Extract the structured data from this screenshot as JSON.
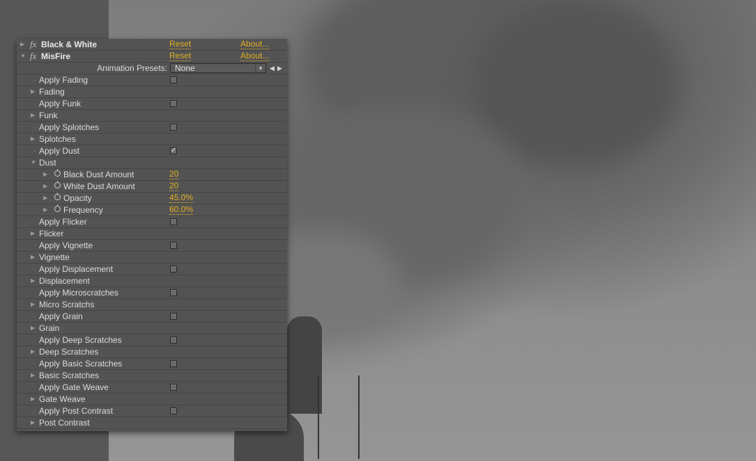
{
  "effects": [
    {
      "name": "Black & White",
      "expanded": false,
      "reset_label": "Reset",
      "about_label": "About..."
    },
    {
      "name": "MisFire",
      "expanded": true,
      "reset_label": "Reset",
      "about_label": "About..."
    }
  ],
  "presets": {
    "label": "Animation Presets:",
    "value": "None"
  },
  "icons": {
    "fx": "fx",
    "twirl_closed": "▶",
    "twirl_open": "▼",
    "dot": "·",
    "dropdown": "▼",
    "prev": "◀",
    "next": "▶",
    "check": "✓"
  },
  "rows": [
    {
      "type": "checkbox",
      "label": "Apply Fading",
      "checked": false
    },
    {
      "type": "group",
      "label": "Fading",
      "expanded": false
    },
    {
      "type": "checkbox",
      "label": "Apply Funk",
      "checked": false
    },
    {
      "type": "group",
      "label": "Funk",
      "expanded": false
    },
    {
      "type": "checkbox",
      "label": "Apply Splotches",
      "checked": false
    },
    {
      "type": "group",
      "label": "Splotches",
      "expanded": false
    },
    {
      "type": "checkbox",
      "label": "Apply Dust",
      "checked": true
    },
    {
      "type": "group",
      "label": "Dust",
      "expanded": true
    },
    {
      "type": "param",
      "label": "Black Dust Amount",
      "value": "20"
    },
    {
      "type": "param",
      "label": "White Dust Amount",
      "value": "20"
    },
    {
      "type": "param",
      "label": "Opacity",
      "value": "45.0%"
    },
    {
      "type": "param",
      "label": "Frequency",
      "value": "60.0%"
    },
    {
      "type": "checkbox",
      "label": "Apply Flicker",
      "checked": false
    },
    {
      "type": "group",
      "label": "Flicker",
      "expanded": false
    },
    {
      "type": "checkbox",
      "label": "Apply Vignette",
      "checked": false
    },
    {
      "type": "group",
      "label": "Vignette",
      "expanded": false
    },
    {
      "type": "checkbox",
      "label": "Apply Displacement",
      "checked": false
    },
    {
      "type": "group",
      "label": "Displacement",
      "expanded": false
    },
    {
      "type": "checkbox",
      "label": "Apply Microscratches",
      "checked": false
    },
    {
      "type": "group",
      "label": "Micro Scratchs",
      "expanded": false
    },
    {
      "type": "checkbox",
      "label": "Apply Grain",
      "checked": false
    },
    {
      "type": "group",
      "label": "Grain",
      "expanded": false
    },
    {
      "type": "checkbox",
      "label": "Apply Deep Scratches",
      "checked": false
    },
    {
      "type": "group",
      "label": "Deep Scratches",
      "expanded": false
    },
    {
      "type": "checkbox",
      "label": "Apply Basic Scratches",
      "checked": false
    },
    {
      "type": "group",
      "label": "Basic Scratches",
      "expanded": false
    },
    {
      "type": "checkbox",
      "label": "Apply Gate Weave",
      "checked": false
    },
    {
      "type": "group",
      "label": "Gate Weave",
      "expanded": false
    },
    {
      "type": "checkbox",
      "label": "Apply Post Contrast",
      "checked": false
    },
    {
      "type": "group",
      "label": "Post Contrast",
      "expanded": false
    }
  ]
}
